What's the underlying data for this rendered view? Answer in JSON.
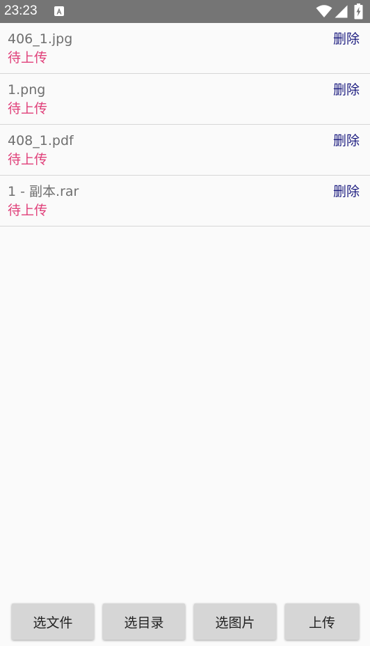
{
  "status_bar": {
    "time": "23:23",
    "notification_icon": "a-icon",
    "icons": [
      "wifi-icon",
      "signal-icon",
      "battery-charging-icon"
    ]
  },
  "colors": {
    "status_bar_bg": "#757575",
    "pending_status": "#e0407a",
    "delete_link": "#1d1d80",
    "file_name": "#6f6f6f",
    "button_bg": "#d6d6d6"
  },
  "files": [
    {
      "name": "406_1.jpg",
      "status": "待上传",
      "delete_label": "删除"
    },
    {
      "name": "1.png",
      "status": "待上传",
      "delete_label": "删除"
    },
    {
      "name": "408_1.pdf",
      "status": "待上传",
      "delete_label": "删除"
    },
    {
      "name": "1 - 副本.rar",
      "status": "待上传",
      "delete_label": "删除"
    }
  ],
  "actions": {
    "select_file": "选文件",
    "select_directory": "选目录",
    "select_image": "选图片",
    "upload": "上传"
  }
}
